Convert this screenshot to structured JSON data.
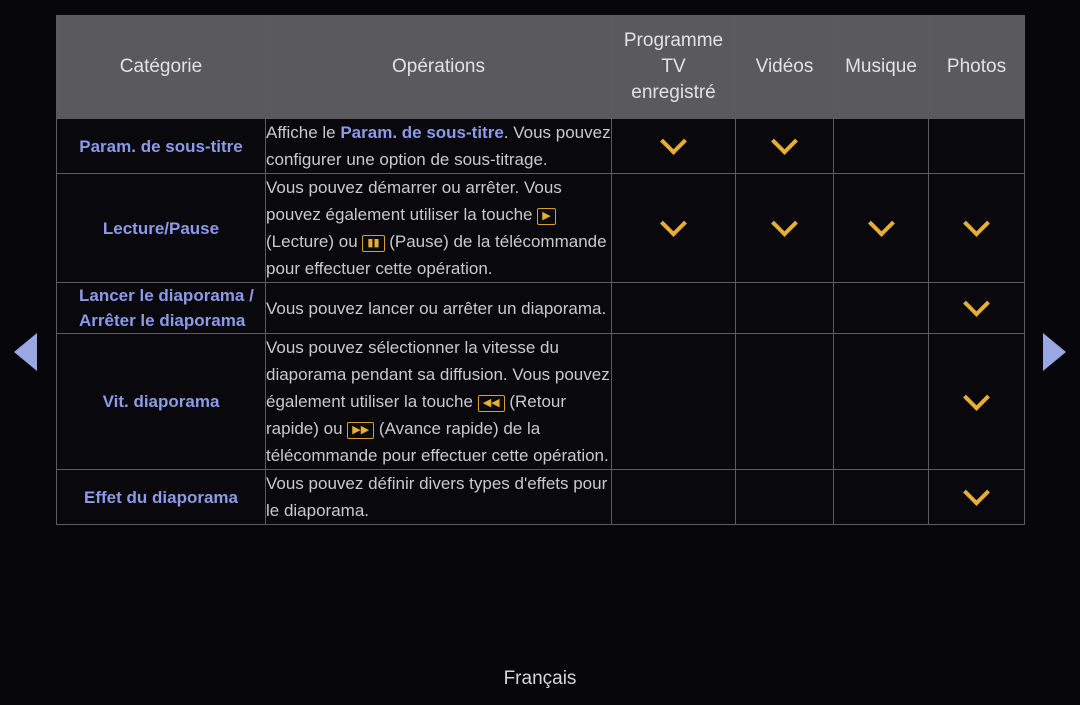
{
  "nav": {
    "prev_icon": "triangle-left-icon",
    "next_icon": "triangle-right-icon",
    "accent": "#9aa7e0"
  },
  "table": {
    "headers": {
      "category": "Catégorie",
      "operations": "Opérations",
      "recorded_tv": "Programme TV enregistré",
      "videos": "Vidéos",
      "music": "Musique",
      "photos": "Photos"
    },
    "rows": [
      {
        "category": "Param. de sous-titre",
        "ops_part1": "Affiche le ",
        "ops_highlight": "Param. de sous-titre",
        "ops_part2": ".  Vous pouvez configurer une option de sous-titrage.",
        "recorded_tv": "chevron-down-icon",
        "videos": "chevron-down-icon",
        "music": "",
        "photos": ""
      },
      {
        "category": "Lecture/Pause",
        "ops_part1": "Vous pouvez démarrer ou arrêter. Vous pouvez également utiliser la touche ",
        "key1": "▶",
        "ops_mid1": " (Lecture) ou ",
        "key2": "▮▮",
        "ops_part2": " (Pause) de la télécommande pour effectuer cette opération.",
        "recorded_tv": "chevron-down-icon",
        "videos": "chevron-down-icon",
        "music": "chevron-down-icon",
        "photos": "chevron-down-icon"
      },
      {
        "category": "Lancer le diaporama / Arrêter le diaporama",
        "ops_part1": "Vous pouvez lancer ou arrêter un diaporama.",
        "recorded_tv": "",
        "videos": "",
        "music": "",
        "photos": "chevron-down-icon"
      },
      {
        "category": "Vit. diaporama",
        "ops_part1": "Vous pouvez sélectionner la vitesse du diaporama pendant sa diffusion. Vous pouvez également utiliser la touche ",
        "key1": "◀◀",
        "ops_mid1": " (Retour rapide) ou ",
        "key2": "▶▶",
        "ops_part2": " (Avance rapide) de la télécommande pour effectuer cette opération.",
        "recorded_tv": "",
        "videos": "",
        "music": "",
        "photos": "chevron-down-icon"
      },
      {
        "category": "Effet du diaporama",
        "ops_part1": "Vous pouvez définir divers types d'effets pour le diaporama.",
        "recorded_tv": "",
        "videos": "",
        "music": "",
        "photos": "chevron-down-icon"
      }
    ]
  },
  "footer": {
    "language": "Français"
  },
  "colors": {
    "highlight_blue": "#8c9ae8",
    "marker_gold": "#e8ae33",
    "header_gray": "#5a5a5e",
    "background": "#07070b"
  }
}
